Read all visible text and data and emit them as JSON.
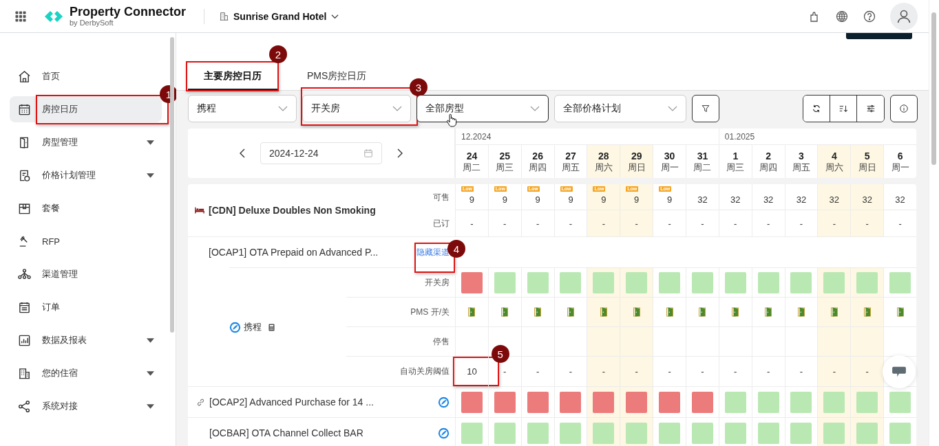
{
  "header": {
    "app_name": "Property Connector",
    "app_byline": "by DerbySoft",
    "hotel": "Sunrise Grand Hotel"
  },
  "sidebar": {
    "items": [
      {
        "label": "首页",
        "selected": false,
        "expandable": false
      },
      {
        "label": "房控日历",
        "selected": true,
        "expandable": false,
        "callout": "1"
      },
      {
        "label": "房型管理",
        "selected": false,
        "expandable": true
      },
      {
        "label": "价格计划管理",
        "selected": false,
        "expandable": true
      },
      {
        "label": "套餐",
        "selected": false,
        "expandable": false
      },
      {
        "label": "RFP",
        "selected": false,
        "expandable": false
      },
      {
        "label": "渠道管理",
        "selected": false,
        "expandable": false
      },
      {
        "label": "订单",
        "selected": false,
        "expandable": false
      },
      {
        "label": "数据及报表",
        "selected": false,
        "expandable": true
      },
      {
        "label": "您的住宿",
        "selected": false,
        "expandable": true
      },
      {
        "label": "系统对接",
        "selected": false,
        "expandable": true
      }
    ]
  },
  "tabs": [
    {
      "label": "主要房控日历",
      "selected": true,
      "callout": "2"
    },
    {
      "label": "PMS房控日历",
      "selected": false
    }
  ],
  "filters": [
    {
      "value": "携程",
      "hovered": false
    },
    {
      "value": "开关房",
      "hovered": false,
      "callout": "3"
    },
    {
      "value": "全部房型",
      "hovered": true
    },
    {
      "value": "全部价格计划",
      "hovered": false
    }
  ],
  "date_picker": {
    "value": "2024-12-24"
  },
  "months": [
    {
      "label": "12.2024"
    },
    {
      "label": "01.2025"
    }
  ],
  "days": [
    {
      "date": "24",
      "weekday": "周二",
      "weekend": false,
      "badge": "Low",
      "available": "9",
      "booked": "-"
    },
    {
      "date": "25",
      "weekday": "周三",
      "weekend": false,
      "badge": "Low",
      "available": "9",
      "booked": "-"
    },
    {
      "date": "26",
      "weekday": "周四",
      "weekend": false,
      "badge": "Low",
      "available": "9",
      "booked": "-"
    },
    {
      "date": "27",
      "weekday": "周五",
      "weekend": false,
      "badge": "Low",
      "available": "9",
      "booked": "-"
    },
    {
      "date": "28",
      "weekday": "周六",
      "weekend": true,
      "badge": "Low",
      "available": "9",
      "booked": "-"
    },
    {
      "date": "29",
      "weekday": "周日",
      "weekend": true,
      "badge": "Low",
      "available": "9",
      "booked": "-"
    },
    {
      "date": "30",
      "weekday": "周一",
      "weekend": false,
      "badge": "Low",
      "available": "9",
      "booked": "-"
    },
    {
      "date": "31",
      "weekday": "周二",
      "weekend": false,
      "available": "32",
      "booked": "-"
    },
    {
      "date": "1",
      "weekday": "周三",
      "weekend": false,
      "available": "32",
      "booked": "-"
    },
    {
      "date": "2",
      "weekday": "周四",
      "weekend": false,
      "available": "32",
      "booked": "-"
    },
    {
      "date": "3",
      "weekday": "周五",
      "weekend": false,
      "available": "32",
      "booked": "-"
    },
    {
      "date": "4",
      "weekday": "周六",
      "weekend": true,
      "available": "32",
      "booked": "-"
    },
    {
      "date": "5",
      "weekday": "周日",
      "weekend": true,
      "available": "32",
      "booked": "-"
    },
    {
      "date": "6",
      "weekday": "周一",
      "weekend": false,
      "available": "32",
      "booked": "-"
    }
  ],
  "room": {
    "name": "[CDN] Deluxe Doubles Non Smoking",
    "available_label": "可售",
    "booked_label": "已订"
  },
  "rate_plans": [
    {
      "kind": "expanded",
      "name": "[OCAP1] OTA Prepaid on Advanced P...",
      "link": "隐藏渠道",
      "callout": "4",
      "channel": {
        "name": "携程",
        "rows": [
          {
            "kind": "status",
            "label": "开关房",
            "cells": [
              {
                "open": false
              },
              {
                "open": true
              },
              {
                "open": true
              },
              {
                "open": true
              },
              {
                "open": true
              },
              {
                "open": true
              },
              {
                "open": true
              },
              {
                "open": true
              },
              {
                "open": true
              },
              {
                "open": true
              },
              {
                "open": true
              },
              {
                "open": true
              },
              {
                "open": true
              },
              {
                "open": true
              }
            ]
          },
          {
            "kind": "pms",
            "label": "PMS 开/关",
            "cells": [
              {
                "open": true
              },
              {
                "open": true
              },
              {
                "open": true
              },
              {
                "open": true
              },
              {
                "open": true
              },
              {
                "open": true
              },
              {
                "open": true
              },
              {
                "open": true
              },
              {
                "open": true
              },
              {
                "open": true
              },
              {
                "open": true
              },
              {
                "open": true
              },
              {
                "open": true
              },
              {
                "open": true
              }
            ]
          },
          {
            "kind": "empty",
            "label": "停售"
          },
          {
            "kind": "threshold",
            "label": "自动关房阈值",
            "cells": [
              {
                "text": "10",
                "callout": "5"
              },
              {
                "text": "-"
              },
              {
                "text": "-"
              },
              {
                "text": "-"
              },
              {
                "text": "-"
              },
              {
                "text": "-"
              },
              {
                "text": "-"
              },
              {
                "text": "-"
              },
              {
                "text": "-"
              },
              {
                "text": "-"
              },
              {
                "text": "-"
              },
              {
                "text": "-"
              },
              {
                "text": "-"
              }
            ]
          }
        ]
      }
    },
    {
      "kind": "collapsed",
      "name": "[OCAP2] Advanced Purchase for 14 ...",
      "linked": true,
      "cells": [
        {
          "open": false
        },
        {
          "open": false
        },
        {
          "open": false
        },
        {
          "open": false
        },
        {
          "open": false
        },
        {
          "open": false
        },
        {
          "open": false
        },
        {
          "open": false
        },
        {
          "open": true
        },
        {
          "open": true
        },
        {
          "open": true
        },
        {
          "open": true
        },
        {
          "open": true
        },
        {
          "open": true
        }
      ]
    },
    {
      "kind": "collapsed",
      "name": "[OCBAR] OTA Channel Collect BAR",
      "linked": false,
      "cells": [
        {
          "open": true
        },
        {
          "open": true
        },
        {
          "open": true
        },
        {
          "open": true
        },
        {
          "open": true
        },
        {
          "open": true
        },
        {
          "open": true
        },
        {
          "open": true
        },
        {
          "open": true
        },
        {
          "open": true
        },
        {
          "open": true
        },
        {
          "open": true
        },
        {
          "open": true
        },
        {
          "open": true
        }
      ]
    }
  ]
}
